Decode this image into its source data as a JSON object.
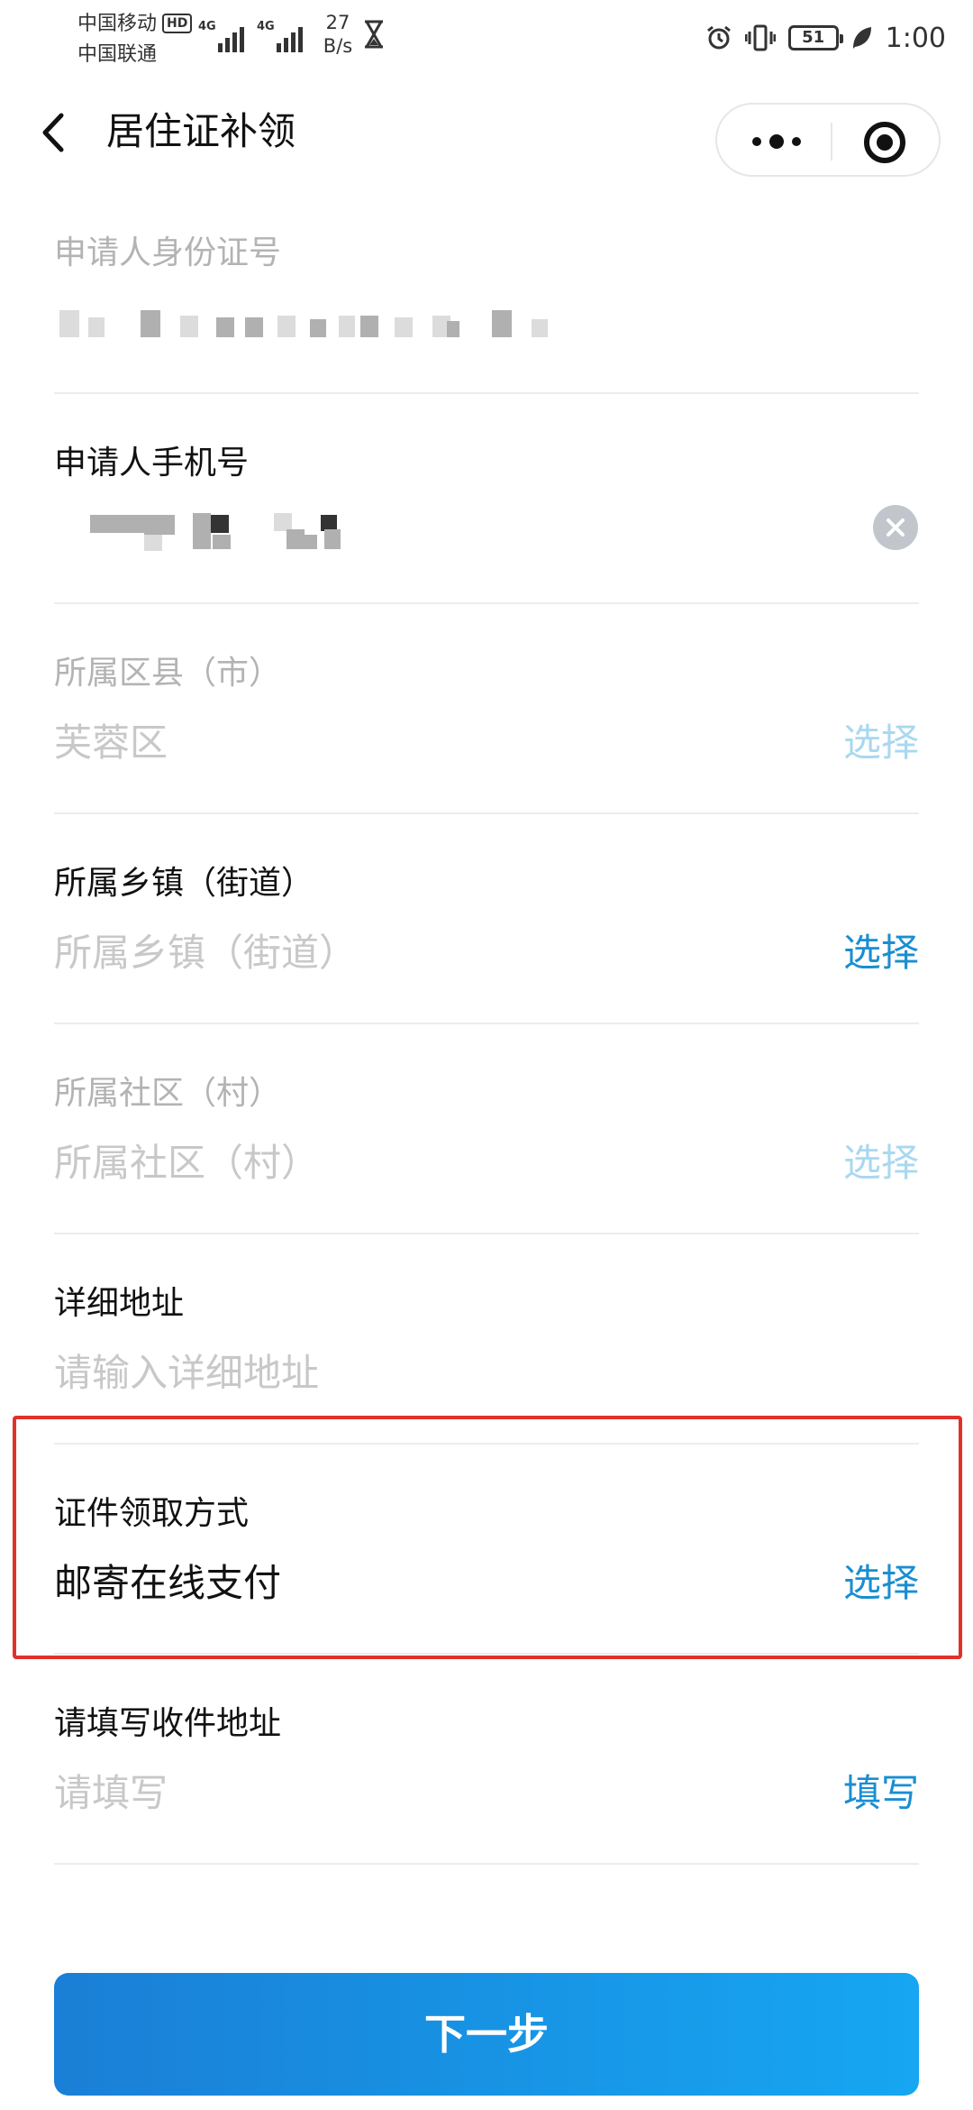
{
  "status_bar": {
    "carrier_1": "中国移动",
    "carrier_1_badge": "HD",
    "carrier_2": "中国联通",
    "signal_1_label": "4G",
    "signal_2_label": "4G",
    "net_speed_value": "27",
    "net_speed_unit": "B/s",
    "battery": "51",
    "time": "1:00"
  },
  "nav": {
    "title": "居住证补领"
  },
  "form": {
    "id_number": {
      "label": "申请人身份证号"
    },
    "phone": {
      "label": "申请人手机号"
    },
    "district": {
      "label": "所属区县（市）",
      "value": "芙蓉区",
      "action": "选择"
    },
    "township": {
      "label": "所属乡镇（街道）",
      "value": "所属乡镇（街道）",
      "action": "选择"
    },
    "community": {
      "label": "所属社区（村）",
      "value": "所属社区（村）",
      "action": "选择"
    },
    "address": {
      "label": "详细地址",
      "placeholder": "请输入详细地址"
    },
    "pickup": {
      "label": "证件领取方式",
      "value": "邮寄在线支付",
      "action": "选择"
    },
    "receiver": {
      "label": "请填写收件地址",
      "placeholder": "请填写",
      "action": "填写"
    }
  },
  "next_button": {
    "label": "下一步"
  },
  "colors": {
    "accent": "#1a8ed1",
    "highlight": "#e0312b",
    "button_start": "#1a7fd6",
    "button_end": "#16a6f2"
  }
}
